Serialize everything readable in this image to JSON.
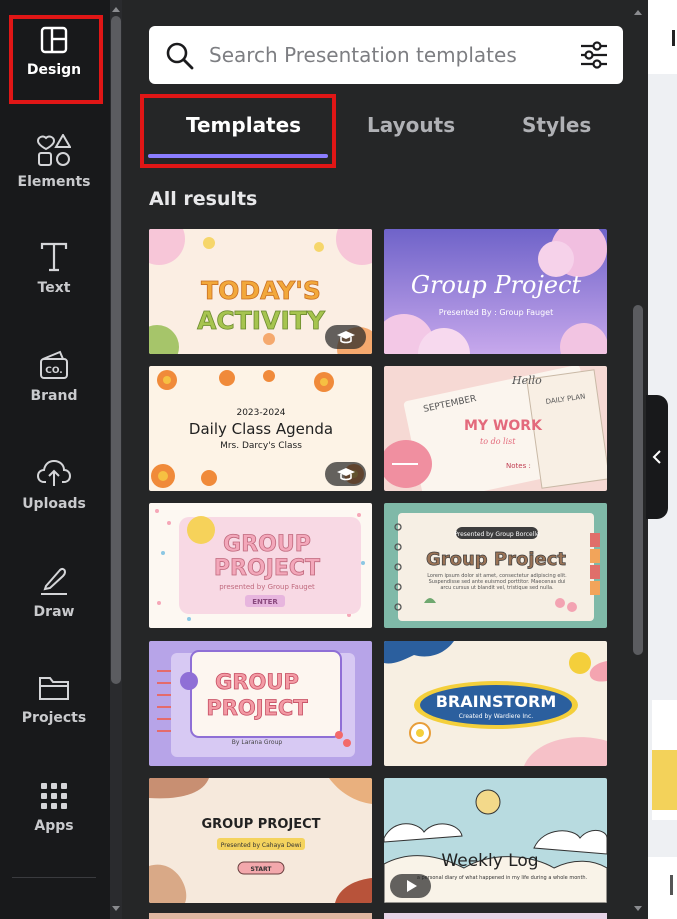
{
  "nav": {
    "items": [
      {
        "label": "Design",
        "icon": "layout-icon",
        "active": true
      },
      {
        "label": "Elements",
        "icon": "shapes-icon"
      },
      {
        "label": "Text",
        "icon": "text-icon"
      },
      {
        "label": "Brand",
        "icon": "brand-icon"
      },
      {
        "label": "Uploads",
        "icon": "cloud-upload-icon"
      },
      {
        "label": "Draw",
        "icon": "pen-icon"
      },
      {
        "label": "Projects",
        "icon": "folder-icon"
      },
      {
        "label": "Apps",
        "icon": "grid-icon"
      }
    ]
  },
  "search": {
    "placeholder": "Search Presentation templates"
  },
  "tabs": [
    {
      "label": "Templates",
      "active": true
    },
    {
      "label": "Layouts"
    },
    {
      "label": "Styles"
    }
  ],
  "results": {
    "heading": "All results",
    "cards": [
      {
        "line1": "TODAY'S",
        "line2": "ACTIVITY",
        "bg": "#fbeee3",
        "badge": "graduation-cap-icon"
      },
      {
        "line1": "Group Project",
        "line2": "Presented By : Group Fauget",
        "bg": "#8e80d9"
      },
      {
        "line1": "2023-2024",
        "line2": "Daily Class Agenda",
        "line3": "Mrs. Darcy's Class",
        "bg": "#fdf3e6",
        "badge": "graduation-cap-icon"
      },
      {
        "line1": "MY WORK",
        "line2": "to do list",
        "line3": "SEPTEMBER",
        "line4": "DAILY PLAN",
        "line5": "Hello",
        "line6": "Notes :",
        "bg": "#f6d9d4"
      },
      {
        "line1": "GROUP",
        "line2": "PROJECT",
        "line3": "presented by Group Fauget",
        "line4": "ENTER",
        "bg": "#fdf8f2"
      },
      {
        "line1": "Group Project",
        "line2": "Presented by Group Borcelle",
        "line3": "Lorem ipsum dolor sit amet, consectetur adipiscing elit. Suspendisse sed ante euismod porttitor. Maecenas dui arcu cursus ut blandit vel, tristique sed nulla.",
        "bg": "#7fb9a8"
      },
      {
        "line1": "GROUP",
        "line2": "PROJECT",
        "line3": "By Larana Group",
        "bg": "#b7a4e8"
      },
      {
        "line1": "BRAINSTORM",
        "line2": "Created by Wardiere Inc.",
        "bg": "#f7efe2"
      },
      {
        "line1": "GROUP PROJECT",
        "line2": "Presented by Cahaya Dewi",
        "line3": "START",
        "bg": "#f6e9dc"
      },
      {
        "line1": "Weekly Log",
        "line2": "a personal diary of what happened in my life during a whole month.",
        "bg": "#b8dbe0",
        "badge": "play-icon"
      }
    ]
  },
  "colors": {
    "accent": "#8b7dff",
    "highlight": "#e01616",
    "rail_bg": "#18191b",
    "panel_bg": "#252627"
  }
}
